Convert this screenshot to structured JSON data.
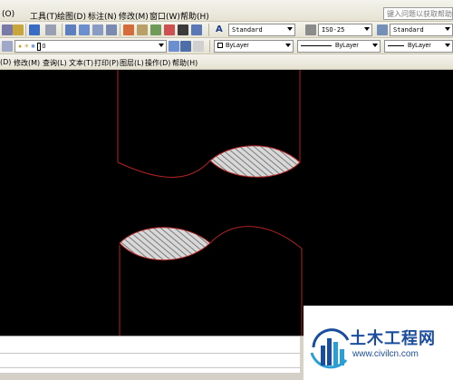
{
  "menubar": {
    "items": [
      "(O)",
      "工具(T)",
      "绘图(D)",
      "标注(N)",
      "修改(M)",
      "窗口(W)",
      "帮助(H)"
    ],
    "help_search_placeholder": "键入问题以获取帮助"
  },
  "toolbar1": {
    "text_style": "Standard",
    "dim_style": "ISO-25",
    "table_style": "Standard"
  },
  "toolbar2": {
    "layer": "0",
    "color": "ByLayer",
    "linetype": "ByLayer",
    "lineweight": "ByLayer"
  },
  "menubar2": {
    "items": [
      "(D)",
      "修改(M)",
      "查询(L)",
      "文本(T)",
      "打印(P)",
      "图层(L)",
      "操作(D)",
      "帮助(H)"
    ]
  },
  "colors": {
    "canvas_bg": "#000000",
    "outline": "#b22222",
    "hatch": "#ffffff",
    "brand": "#1b4d9e"
  },
  "watermark": {
    "title": "土木工程网",
    "url": "www.civilcn.com"
  }
}
